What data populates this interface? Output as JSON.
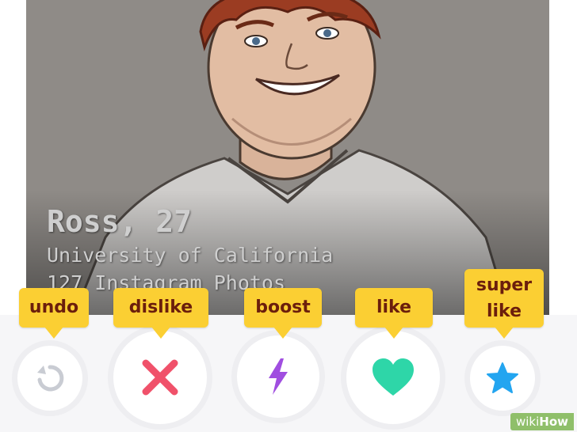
{
  "profile": {
    "name_age": "Ross, 27",
    "school": "University of California",
    "photos": "127 Instagram Photos"
  },
  "actions": [
    {
      "label": "undo",
      "icon": "undo-icon",
      "color": "#c9ccd3"
    },
    {
      "label": "dislike",
      "icon": "x-icon",
      "color": "#f0516a"
    },
    {
      "label": "boost",
      "icon": "lightning-bolt-icon",
      "color": "#a04ee0"
    },
    {
      "label": "like",
      "icon": "heart-icon",
      "color": "#2ed6a8"
    },
    {
      "label": "super like",
      "icon": "star-icon",
      "color": "#23a5f0"
    }
  ],
  "label_color": "#fbcf33",
  "watermark": {
    "part1": "wiki",
    "part2": "How"
  }
}
